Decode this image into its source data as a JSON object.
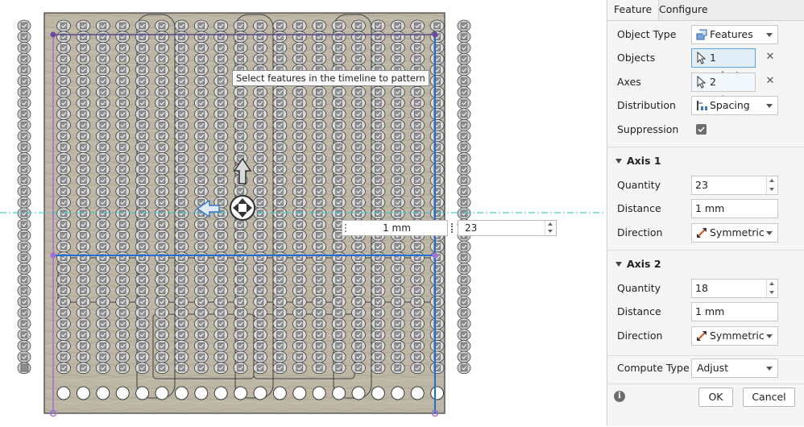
{
  "viewport": {
    "tooltip": "Select features in the timeline to pattern",
    "distance_input": "1 mm",
    "quantity_input": "23"
  },
  "panel": {
    "tabs": [
      {
        "label": "Feature",
        "active": true
      },
      {
        "label": "Configure",
        "active": false
      }
    ],
    "object_type": {
      "label": "Object Type",
      "value": "Features",
      "icon": "features-icon"
    },
    "objects": {
      "label": "Objects",
      "value": "1 select...",
      "icon": "cursor-select-icon"
    },
    "axes": {
      "label": "Axes",
      "value": "2 select...",
      "icon": "cursor-select-icon"
    },
    "distribution": {
      "label": "Distribution",
      "value": "Spacing",
      "icon": "spacing-icon"
    },
    "suppression": {
      "label": "Suppression",
      "checked": true
    },
    "axis1": {
      "title": "Axis 1",
      "quantity_label": "Quantity",
      "quantity": "23",
      "distance_label": "Distance",
      "distance": "1 mm",
      "direction_label": "Direction",
      "direction": "Symmetric"
    },
    "axis2": {
      "title": "Axis 2",
      "quantity_label": "Quantity",
      "quantity": "18",
      "distance_label": "Distance",
      "distance": "1 mm",
      "direction_label": "Direction",
      "direction": "Symmetric"
    },
    "compute_type": {
      "label": "Compute Type",
      "value": "Adjust"
    },
    "ok_label": "OK",
    "cancel_label": "Cancel"
  },
  "colors": {
    "accent": "#1f6fd6",
    "selection_border": "#5ba3d8",
    "axis_line": "#20c8c8",
    "sketch_purple": "#a26fd6",
    "board_fill": "#bdb6a5"
  }
}
